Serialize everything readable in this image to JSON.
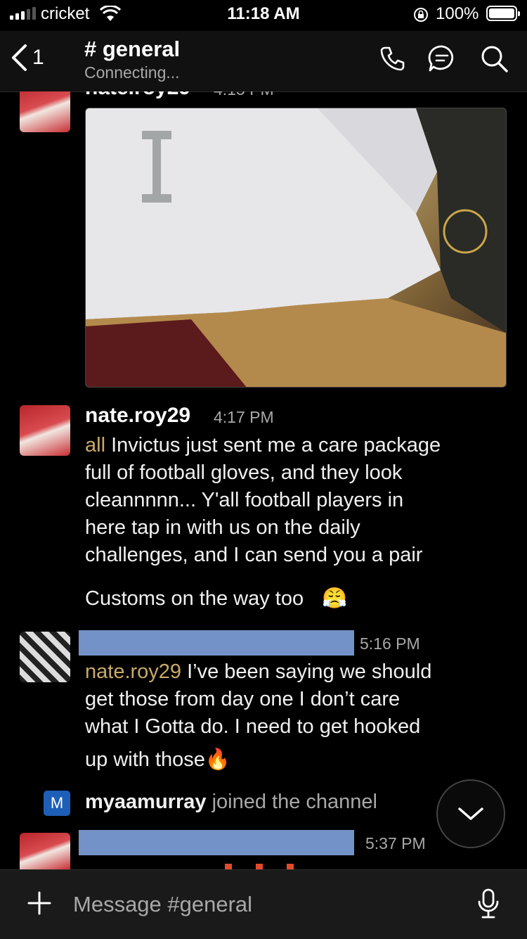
{
  "status_bar": {
    "carrier": "cricket",
    "time": "11:18 AM",
    "battery": "100%"
  },
  "header": {
    "back_count": "1",
    "channel": "# general",
    "status": "Connecting..."
  },
  "messages": [
    {
      "user": "nate.roy29",
      "time": "4:15 PM",
      "has_image": true
    },
    {
      "user": "nate.roy29",
      "time": "4:17 PM",
      "mention": "all",
      "lines": [
        "Invictus just sent me a care package",
        "full of football gloves, and they look",
        "cleannnnn... Y'all football players in",
        "here tap in with us on the daily",
        "challenges, and I can send you a pair"
      ],
      "line2": "Customs on the way too",
      "emoji": "😤"
    },
    {
      "time": "5:16 PM",
      "mention": "nate.roy29",
      "lines": [
        "I’ve been saying we should",
        "get those from day one I don’t care",
        "what I Gotta do. I need to get hooked",
        "up with those"
      ],
      "emoji": "🔥"
    },
    {
      "badge": "M",
      "user": "myaamurray",
      "text": "joined the channel"
    },
    {
      "time": "5:37 PM"
    }
  ],
  "composer": {
    "placeholder": "Message #general"
  },
  "colors": {
    "mention": "#c9a96a",
    "redaction": "#7393c8",
    "badge": "#1d5fb7"
  }
}
